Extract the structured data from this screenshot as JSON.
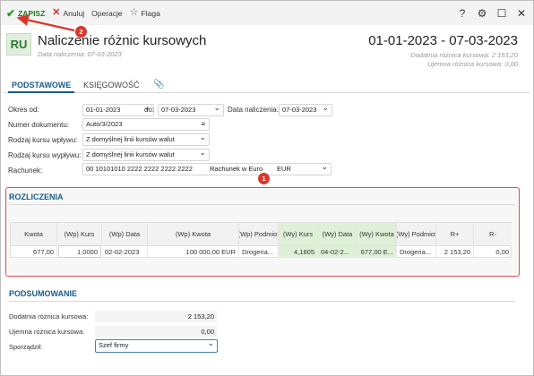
{
  "toolbar": {
    "save": "ZAPISZ",
    "cancel": "Anuluj",
    "operations": "Operacje",
    "flag": "Flaga"
  },
  "window_controls": {
    "help": "?",
    "settings": "⚙",
    "maximize": "☐",
    "close": "✕"
  },
  "header": {
    "badge": "RU",
    "title": "Naliczenie różnic kursowych",
    "subtitle": "Data naliczenia: 07-03-2023",
    "date_range": "01-01-2023 - 07-03-2023",
    "positive_diff": "Dodatnia różnica kursowa: 2 153,20",
    "negative_diff": "Ujemna różnica kursowa: 0,00"
  },
  "tabs": {
    "basic": "PODSTAWOWE",
    "accounting": "KSIĘGOWOŚĆ",
    "attachment": "📎"
  },
  "form": {
    "period_label": "Okres od:",
    "period_from": "01-01-2023",
    "to_label": "do:",
    "period_to": "07-03-2023",
    "calc_date_label": "Data naliczenia:",
    "calc_date": "07-03-2023",
    "doc_number_label": "Numer dokumentu:",
    "doc_number": "Auto/3/2023",
    "rate_in_label": "Rodzaj kursu wpływu:",
    "rate_in": "Z domyślnej linii kursów walut",
    "rate_out_label": "Rodzaj kursu wypływu:",
    "rate_out": "Z domyślnej linii kursów walut",
    "account_label": "Rachunek:",
    "account": "00 10101010 2222 2222 2222 2222",
    "account_name": "Rachunek w Euro",
    "currency": "EUR"
  },
  "settlements": {
    "title": "ROZLICZENIA",
    "columns": [
      "Kwota",
      "(Wp) Kurs",
      "(Wp) Data",
      "(Wp) Kwota",
      "(Wp) Podmiot",
      "(Wy) Kurs",
      "(Wy) Data",
      "(Wy) Kwota",
      "(Wy) Podmiot",
      "R+",
      "R-"
    ],
    "row": [
      "677,00",
      "1,0000",
      "02-02-2023",
      "100 000,00 EUR",
      "Drogeria...",
      "4,1805",
      "04-02-2...",
      "677,00 E...",
      "Drogeria...",
      "2 153,20",
      "0,00"
    ]
  },
  "summary": {
    "title": "PODSUMOWANIE",
    "positive_label": "Dodatnia różnica kursowa:",
    "positive_value": "2 153,20",
    "negative_label": "Ujemna różnica kursowa:",
    "negative_value": "0,00",
    "author_label": "Sporządził:",
    "author_value": "Szef firmy"
  },
  "annotations": {
    "one": "1",
    "two": "2"
  },
  "colors": {
    "accent": "#1a5c8c",
    "save_green": "#2b9a2b",
    "highlight_red": "#d9534f",
    "incoming_green": "#dff0d8"
  }
}
